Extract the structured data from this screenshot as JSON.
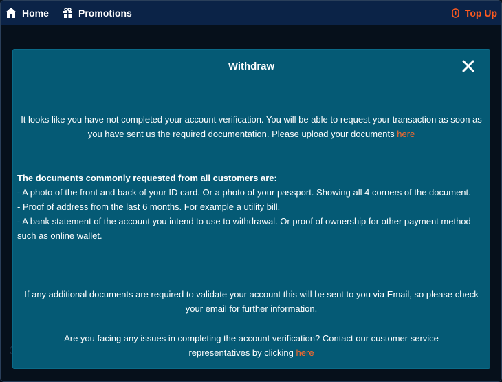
{
  "nav": {
    "home_label": "Home",
    "promotions_label": "Promotions",
    "topup_label": "Top Up"
  },
  "modal": {
    "title": "Withdraw",
    "message1": "It looks like you have not completed your account verification. You will be able to request your transaction as soon as you have sent us the required documentation. Please upload your documents",
    "message1_link": "here",
    "docs_heading": "The documents commonly requested from all customers are:",
    "docs_items": [
      "- A photo of the front and back of your ID card. Or a photo of your passport. Showing all 4 corners of the document.",
      "- Proof of address from the last 6 months. For example a utility bill.",
      "- A bank statement of the account you intend to use to withdrawal. Or proof of ownership for other payment method such as online wallet."
    ],
    "message2": "If any additional documents are required to validate your account this will be sent to you via Email, so please check your email for further information.",
    "message3": "Are you facing any issues in completing the account verification? Contact our customer service representatives by clicking",
    "message3_link": "here"
  },
  "colors": {
    "topbar": "#0b2347",
    "modal": "#055a75",
    "accent": "#ff6a2a"
  },
  "icons": [
    "home-icon",
    "gift-icon",
    "topup-icon",
    "close-icon"
  ]
}
